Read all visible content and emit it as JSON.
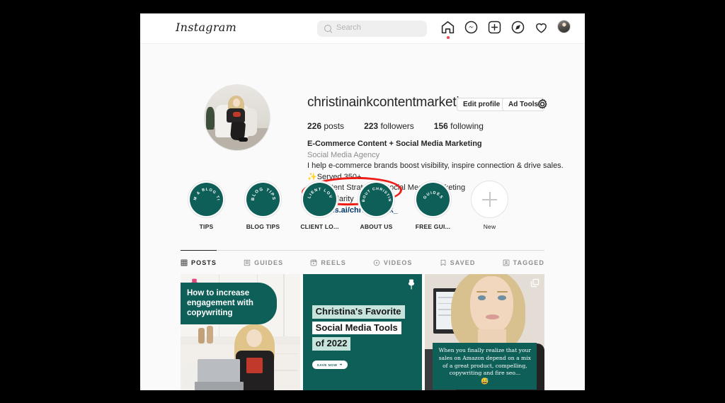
{
  "colors": {
    "brand_teal": "#0f5f59",
    "link_blue": "#00376b",
    "annotation_red": "#ee1c17",
    "notification_red": "#ed4956",
    "page_bg": "#fafafa"
  },
  "topbar": {
    "logo": "Instagram",
    "logo_caret_icon": "chevron-down-icon",
    "search": {
      "placeholder": "Search",
      "value": "",
      "icon": "search-icon"
    },
    "nav_icons": [
      {
        "name": "home-icon",
        "label": "Home",
        "active": true,
        "has_notification_dot": true
      },
      {
        "name": "messenger-icon",
        "label": "Messenger",
        "active": false,
        "has_notification_dot": false
      },
      {
        "name": "new-post-icon",
        "label": "New post",
        "active": false,
        "has_notification_dot": false
      },
      {
        "name": "explore-compass-icon",
        "label": "Explore",
        "active": false,
        "has_notification_dot": false
      },
      {
        "name": "heart-activity-icon",
        "label": "Activity",
        "active": false,
        "has_notification_dot": false
      },
      {
        "name": "profile-avatar-icon",
        "label": "Profile",
        "active": false,
        "has_notification_dot": false
      }
    ]
  },
  "profile": {
    "username": "christinainkcontentmarketing",
    "avatar_icon": "profile-picture",
    "edit_profile_label": "Edit profile",
    "ad_tools_label": "Ad Tools",
    "settings_icon": "gear-icon",
    "stats": [
      {
        "count": "226",
        "label": "posts"
      },
      {
        "count": "223",
        "label": "followers"
      },
      {
        "count": "156",
        "label": "following"
      }
    ],
    "bio": {
      "display_name": "E-Commerce Content + Social Media Marketing",
      "category": "Social Media Agency",
      "line1": "I help e-commerce brands boost visibility, inspire connection & drive sales. ✨Served 350+",
      "line2": "🔘Content Strategy + Social Media Marketing",
      "line3": "✨Get Clarity",
      "link": "beacons.ai/christinaink_"
    }
  },
  "annotation": {
    "type": "red-ellipse",
    "target": "beacons.ai/christinaink_"
  },
  "highlights": [
    {
      "label": "TIPS",
      "cover_text": "SMM & BLOG TIPS",
      "is_new": false
    },
    {
      "label": "BLOG TIPS",
      "cover_text": "BLOG TIPS",
      "is_new": false
    },
    {
      "label": "CLIENT LO...",
      "cover_text": "CLIENT LOVE",
      "is_new": false
    },
    {
      "label": "ABOUT US",
      "cover_text": "ABOUT CHRISTINA",
      "is_new": false
    },
    {
      "label": "FREE GUI...",
      "cover_text": "GUIDES",
      "is_new": false
    },
    {
      "label": "New",
      "cover_text": "",
      "is_new": true
    }
  ],
  "tabs": [
    {
      "label": "POSTS",
      "icon": "grid-icon",
      "active": true
    },
    {
      "label": "GUIDES",
      "icon": "guides-bookmark-icon",
      "active": false
    },
    {
      "label": "REELS",
      "icon": "reels-clapper-icon",
      "active": false
    },
    {
      "label": "VIDEOS",
      "icon": "video-play-icon",
      "active": false
    },
    {
      "label": "SAVED",
      "icon": "saved-bookmark-icon",
      "active": false
    },
    {
      "label": "TAGGED",
      "icon": "tagged-person-icon",
      "active": false
    }
  ],
  "posts": [
    {
      "id": "post-1",
      "overlay_text": "How to increase engagement with copywriting",
      "badge_icon": "pushpin-icon",
      "type": "image"
    },
    {
      "id": "post-2",
      "title_line1": "Christina's Favorite",
      "title_line2": "Social Media Tools",
      "title_line3": "of 2022",
      "cta_label": "SAVE NOW",
      "cta_icon": "arrow-right-icon",
      "badge_icon": "pushpin-icon",
      "type": "graphic"
    },
    {
      "id": "post-3",
      "quote": "When you finally realize that your sales on Amazon depend on a mix of a great product, compelling, copywriting and fire seo...",
      "quote_emoji": "😅",
      "badge_icon": "carousel-icon",
      "type": "carousel"
    }
  ]
}
